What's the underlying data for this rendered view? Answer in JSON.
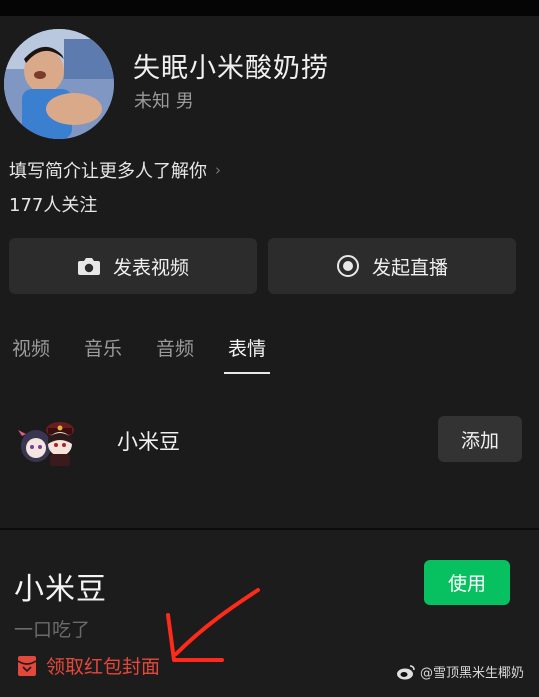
{
  "profile": {
    "name": "失眠小米酸奶捞",
    "meta": "未知 男",
    "bio_prompt": "填写简介让更多人了解你",
    "following": "177人关注"
  },
  "actions": {
    "post_video": "发表视频",
    "start_live": "发起直播"
  },
  "tabs": [
    {
      "label": "视频",
      "active": false
    },
    {
      "label": "音乐",
      "active": false
    },
    {
      "label": "音频",
      "active": false
    },
    {
      "label": "表情",
      "active": true
    }
  ],
  "sticker": {
    "name": "小米豆",
    "add_label": "添加"
  },
  "panel": {
    "title": "小米豆",
    "subtitle": "一口吃了",
    "use_label": "使用",
    "red_packet_label": "领取红包封面"
  },
  "watermark": {
    "text": "@雪顶黑米生椰奶"
  },
  "colors": {
    "accent_green": "#07c160",
    "red_packet": "#e5473a",
    "annotation_arrow": "#ff2a1a"
  }
}
